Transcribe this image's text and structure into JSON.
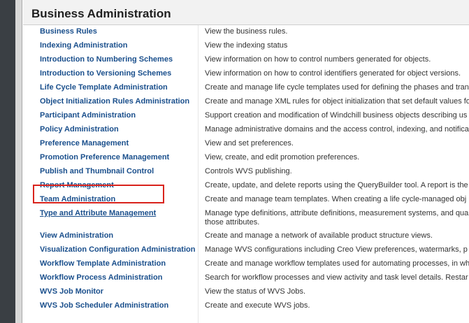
{
  "header": {
    "title": "Business Administration"
  },
  "colors": {
    "link": "#1a4f8c",
    "highlight": "#d9231c",
    "rail": "#3a3f44"
  },
  "items": [
    {
      "name": "Business Rules",
      "desc": "View the business rules."
    },
    {
      "name": "Indexing Administration",
      "desc": "View the indexing status"
    },
    {
      "name": "Introduction to Numbering Schemes",
      "desc": "View information on how to control numbers generated for objects."
    },
    {
      "name": "Introduction to Versioning Schemes",
      "desc": "View information on how to control identifiers generated for object versions."
    },
    {
      "name": "Life Cycle Template Administration",
      "desc": "Create and manage life cycle templates used for defining the phases and tran"
    },
    {
      "name": "Object Initialization Rules Administration",
      "desc": "Create and manage XML rules for object initialization that set default values fo"
    },
    {
      "name": "Participant Administration",
      "desc": "Support creation and modification of Windchill business objects describing us"
    },
    {
      "name": "Policy Administration",
      "desc": "Manage administrative domains and the access control, indexing, and notifica"
    },
    {
      "name": "Preference Management",
      "desc": "View and set preferences."
    },
    {
      "name": "Promotion Preference Management",
      "desc": "View, create, and edit promotion preferences."
    },
    {
      "name": "Publish and Thumbnail Control",
      "desc": "Controls WVS publishing."
    },
    {
      "name": "Report Management",
      "desc": "Create, update, and delete reports using the QueryBuilder tool. A report is the"
    },
    {
      "name": "Team Administration",
      "desc": "Create and manage team templates. When creating a life cycle-managed obj"
    },
    {
      "name": "Type and Attribute Management",
      "desc": "Manage type definitions, attribute definitions, measurement systems, and qua those attributes."
    },
    {
      "name": "View Administration",
      "desc": "Create and manage a network of available product structure views."
    },
    {
      "name": "Visualization Configuration Administration",
      "desc": "Manage WVS configurations including Creo View preferences, watermarks, p"
    },
    {
      "name": "Workflow Template Administration",
      "desc": "Create and manage workflow templates used for automating processes, in wh"
    },
    {
      "name": "Workflow Process Administration",
      "desc": "Search for workflow processes and view activity and task level details. Restar"
    },
    {
      "name": "WVS Job Monitor",
      "desc": "View the status of WVS Jobs."
    },
    {
      "name": "WVS Job Scheduler Administration",
      "desc": "Create and execute WVS jobs."
    }
  ]
}
